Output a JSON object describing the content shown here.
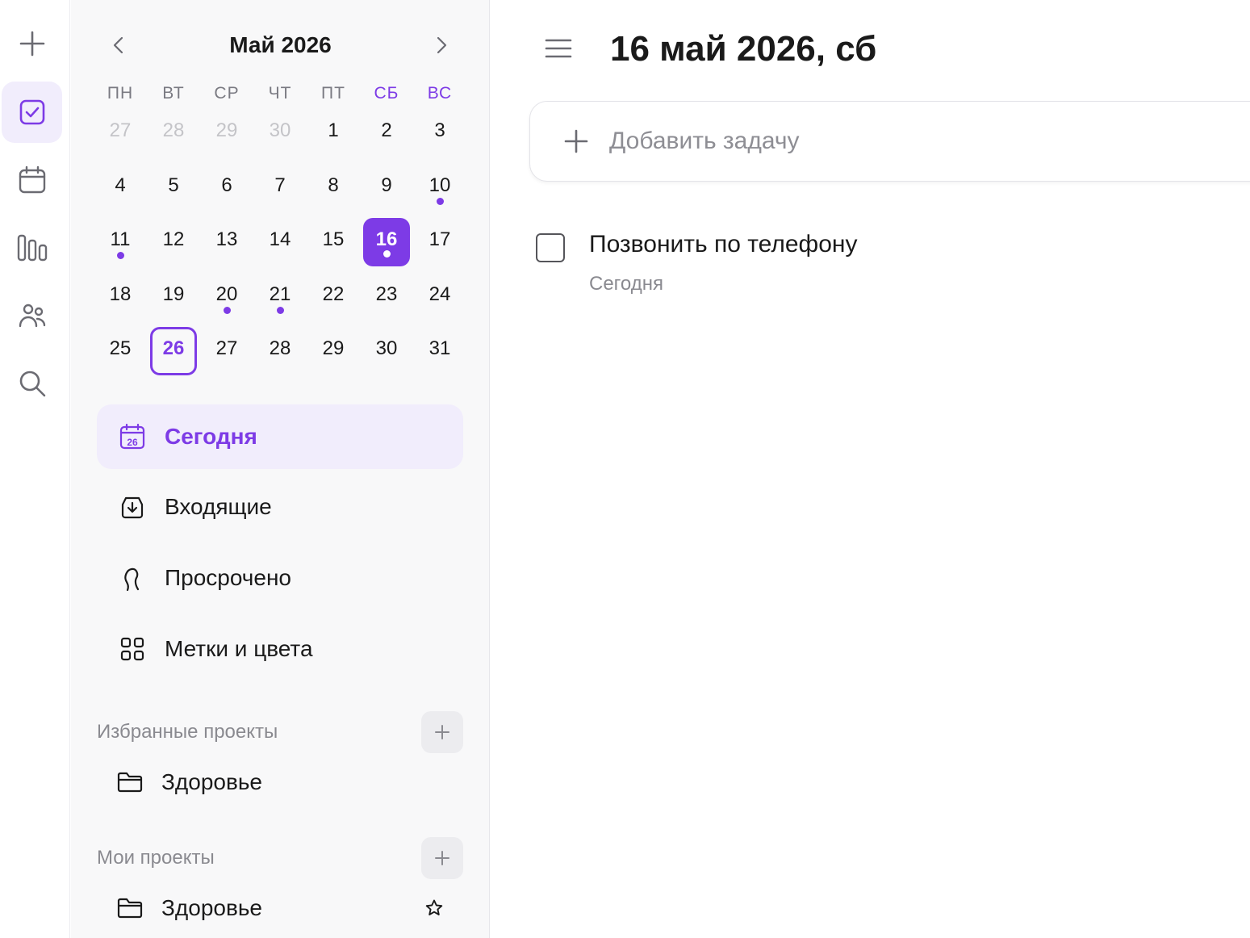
{
  "colors": {
    "accent": "#7d3be6",
    "accent_soft": "#f1edfc",
    "muted_text": "#8a8a90"
  },
  "rail": {
    "items": [
      {
        "name": "add",
        "icon": "plus-icon"
      },
      {
        "name": "tasks",
        "icon": "check-square-icon",
        "active": true
      },
      {
        "name": "calendar",
        "icon": "calendar-icon"
      },
      {
        "name": "boards",
        "icon": "columns-icon"
      },
      {
        "name": "people",
        "icon": "people-icon"
      },
      {
        "name": "search",
        "icon": "search-icon"
      }
    ]
  },
  "calendar": {
    "title": "Май 2026",
    "weekdays": [
      "ПН",
      "ВТ",
      "СР",
      "ЧТ",
      "ПТ",
      "СБ",
      "ВС"
    ],
    "weeks": [
      [
        {
          "d": "27",
          "muted": true
        },
        {
          "d": "28",
          "muted": true
        },
        {
          "d": "29",
          "muted": true
        },
        {
          "d": "30",
          "muted": true
        },
        {
          "d": "1"
        },
        {
          "d": "2"
        },
        {
          "d": "3"
        }
      ],
      [
        {
          "d": "4"
        },
        {
          "d": "5"
        },
        {
          "d": "6"
        },
        {
          "d": "7"
        },
        {
          "d": "8"
        },
        {
          "d": "9"
        },
        {
          "d": "10",
          "dot": true
        }
      ],
      [
        {
          "d": "11",
          "dot": true
        },
        {
          "d": "12"
        },
        {
          "d": "13"
        },
        {
          "d": "14"
        },
        {
          "d": "15"
        },
        {
          "d": "16",
          "dot": true,
          "selected": true
        },
        {
          "d": "17"
        }
      ],
      [
        {
          "d": "18"
        },
        {
          "d": "19"
        },
        {
          "d": "20",
          "dot": true
        },
        {
          "d": "21",
          "dot": true
        },
        {
          "d": "22"
        },
        {
          "d": "23"
        },
        {
          "d": "24"
        }
      ],
      [
        {
          "d": "25"
        },
        {
          "d": "26",
          "today": true
        },
        {
          "d": "27"
        },
        {
          "d": "28"
        },
        {
          "d": "29"
        },
        {
          "d": "30"
        },
        {
          "d": "31"
        }
      ]
    ]
  },
  "nav": {
    "today": "Сегодня",
    "today_icon_day": "26",
    "inbox": "Входящие",
    "overdue": "Просрочено",
    "labels": "Метки и цвета"
  },
  "favorites": {
    "title": "Избранные проекты",
    "projects": [
      {
        "label": "Здоровье"
      }
    ]
  },
  "my_projects": {
    "title": "Мои проекты",
    "projects": [
      {
        "label": "Здоровье"
      }
    ]
  },
  "main": {
    "title": "16 май 2026, сб",
    "add_task_placeholder": "Добавить задачу",
    "tasks": [
      {
        "title": "Позвонить по телефону",
        "date": "Сегодня"
      }
    ]
  }
}
